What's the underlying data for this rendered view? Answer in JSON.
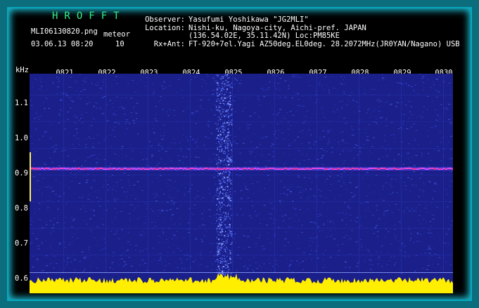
{
  "app": {
    "title": "HROFFT"
  },
  "capture": {
    "filename": "MLI06130820.png",
    "mode": "meteor",
    "date_time": "03.06.13 08:20",
    "count": "10"
  },
  "station": {
    "observer_label": "Observer:",
    "observer": "Yasufumi Yoshikawa \"JG2MLI\"",
    "location_label": "Location:",
    "location": "Nishi-ku, Nagoya-city, Aichi-pref. JAPAN",
    "coords": "(136.54.02E, 35.11.42N) Loc:PM85KE",
    "rx_label": "Rx+Ant:",
    "rx": "FT-920+7el.Yagi AZ50deg.EL0deg. 28.2072MHz(JR0YAN/Nagano) USB"
  },
  "axis": {
    "unit": "kHz",
    "y_ticks": [
      "1.1",
      "1.0",
      "0.9",
      "0.8",
      "0.7",
      "0.6"
    ],
    "x_ticks": [
      "0821",
      "0822",
      "0823",
      "0824",
      "0825",
      "0826",
      "0827",
      "0828",
      "0829",
      "0830"
    ]
  },
  "colors": {
    "background": "#1a1f8a",
    "trace": "#ff3aa0",
    "level_meter": "#ffee00",
    "frame": "#0c6d7c",
    "title": "#33ee88"
  }
}
